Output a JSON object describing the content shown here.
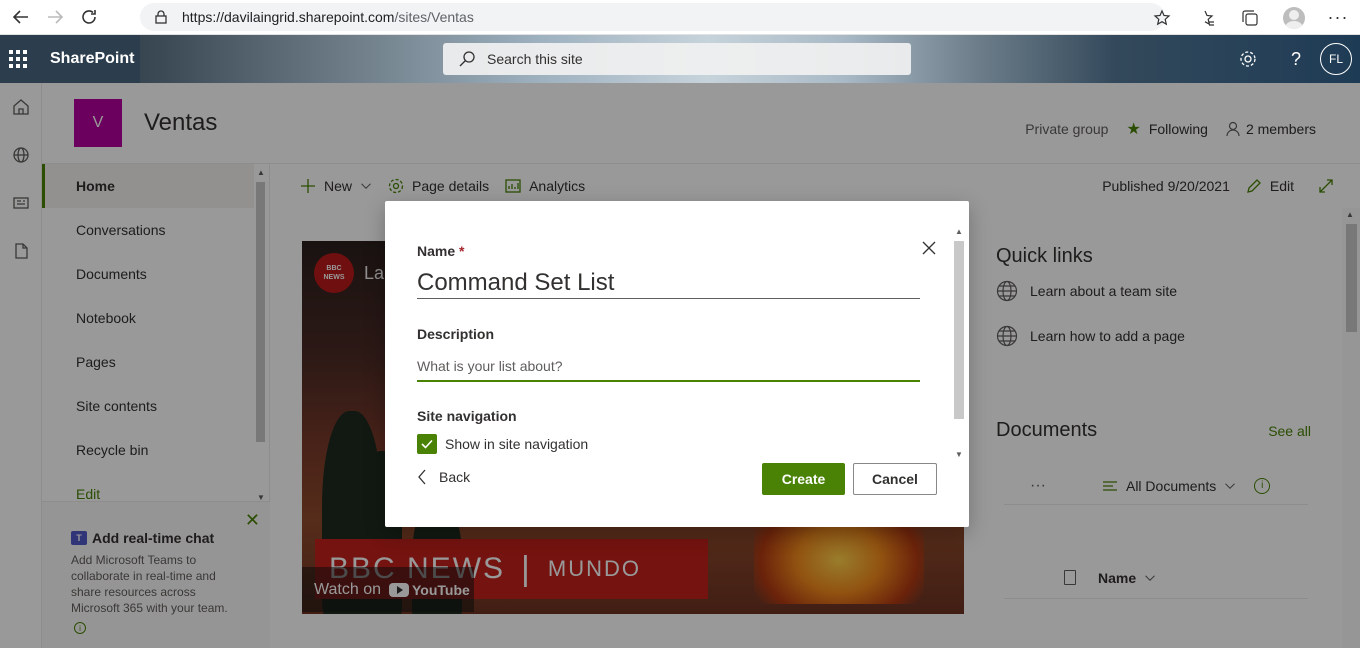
{
  "browser": {
    "url_host": "https://davilaingrid.sharepoint.com",
    "url_path": "/sites/Ventas"
  },
  "suite": {
    "brand": "SharePoint",
    "search_placeholder": "Search this site",
    "user_initials": "FL"
  },
  "site": {
    "logo_letter": "V",
    "title": "Ventas",
    "privacy": "Private group",
    "following_label": "Following",
    "members_label": "2 members"
  },
  "nav": {
    "items": [
      {
        "label": "Home"
      },
      {
        "label": "Conversations"
      },
      {
        "label": "Documents"
      },
      {
        "label": "Notebook"
      },
      {
        "label": "Pages"
      },
      {
        "label": "Site contents"
      },
      {
        "label": "Recycle bin"
      }
    ],
    "edit_label": "Edit"
  },
  "chat_promo": {
    "title": "Add real-time chat",
    "description": "Add Microsoft Teams to collaborate in real-time and share resources across Microsoft 365 with your team."
  },
  "commandbar": {
    "new_label": "New",
    "page_details_label": "Page details",
    "analytics_label": "Analytics",
    "published_label": "Published 9/20/2021",
    "edit_label": "Edit"
  },
  "video": {
    "badge_line1": "BBC",
    "badge_line2": "NEWS",
    "title_fragment": "La",
    "banner_bbc": "BBC NEWS",
    "banner_sep": "|",
    "banner_mundo": "MUNDO",
    "watch_on": "Watch on",
    "youtube": "YouTube"
  },
  "quick_links": {
    "title": "Quick links",
    "items": [
      {
        "label": "Learn about a team site"
      },
      {
        "label": "Learn how to add a page"
      }
    ]
  },
  "documents": {
    "title": "Documents",
    "see_all": "See all",
    "more": "···",
    "view_label": "All Documents",
    "name_column": "Name"
  },
  "dialog": {
    "name_label": "Name",
    "required_mark": "*",
    "name_value": "Command Set List",
    "description_label": "Description",
    "description_placeholder": "What is your list about?",
    "description_value": "",
    "site_nav_label": "Site navigation",
    "show_in_nav_label": "Show in site navigation",
    "show_in_nav_checked": true,
    "back_label": "Back",
    "create_label": "Create",
    "cancel_label": "Cancel"
  },
  "colors": {
    "accent": "#498205",
    "logo": "#b4009e",
    "bbc_red": "#c1201c"
  }
}
